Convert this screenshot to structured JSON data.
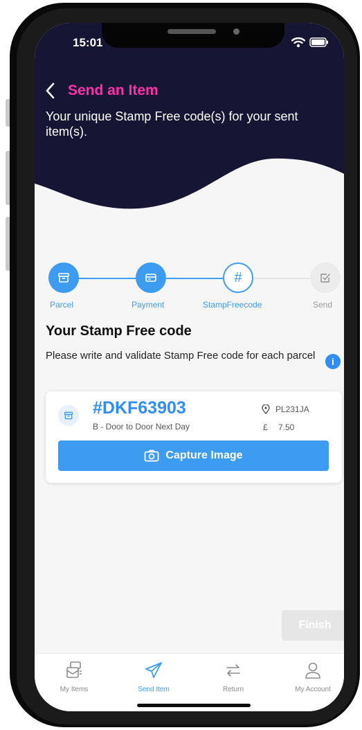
{
  "status_bar": {
    "time": "15:01"
  },
  "header": {
    "title": "Send an Item",
    "subtitle": "Your unique Stamp Free code(s) for your sent item(s).",
    "back_icon": "chevron-left-icon"
  },
  "steps": [
    {
      "label": "Parcel",
      "state": "done",
      "icon": "archive-box-icon"
    },
    {
      "label": "Payment",
      "state": "done",
      "icon": "card-icon"
    },
    {
      "label": "StampFreecode",
      "state": "current",
      "icon": "hash-icon",
      "glyph": "#"
    },
    {
      "label": "Send",
      "state": "upcoming",
      "icon": "checkbox-icon"
    }
  ],
  "section": {
    "title": "Your Stamp Free code",
    "description": "Please write and validate Stamp Free code for each parcel",
    "info_glyph": "i"
  },
  "parcel": {
    "code": "#DKF63903",
    "service": "B - Door to Door Next Day",
    "postcode": "PL231JA",
    "currency": "£",
    "price": "7.50",
    "capture_label": "Capture Image"
  },
  "finish_label": "Finish",
  "tabs": [
    {
      "label": "My Items",
      "icon": "items-icon",
      "active": false
    },
    {
      "label": "Send Item",
      "icon": "paper-plane-icon",
      "active": true
    },
    {
      "label": "Return",
      "icon": "return-arrows-icon",
      "active": false
    },
    {
      "label": "My Account",
      "icon": "user-icon",
      "active": false
    }
  ],
  "colors": {
    "header_bg": "#161634",
    "accent": "#3d9cf0",
    "title_pink": "#ff2fa8",
    "screen_bg": "#f6f6f7",
    "finish_disabled": "#e6e6e6"
  }
}
